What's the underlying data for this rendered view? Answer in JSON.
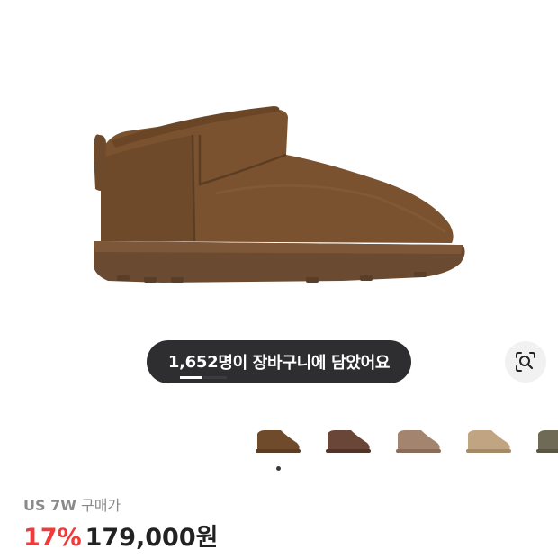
{
  "cart_notice": {
    "count": "1,652",
    "text": "명이 장바구니에 담았어요"
  },
  "icons": {
    "lens": "visual-search-icon"
  },
  "thumbnails": [
    {
      "label": "chestnut",
      "color": "#6f4a2b"
    },
    {
      "label": "burnt cedar",
      "color": "#6a4639"
    },
    {
      "label": "sand",
      "color": "#a3846f"
    },
    {
      "label": "mustard seed",
      "color": "#c1a582"
    },
    {
      "label": "burnt olive",
      "color": "#6f6a56"
    }
  ],
  "pagination": {
    "active_index": 0,
    "total": 1
  },
  "product": {
    "size": "US 7W",
    "price_type": "구매가",
    "discount": "17%",
    "price": "179,000원"
  },
  "colors": {
    "discount": "#ef3b3b",
    "pill_bg": "#2e2e31",
    "boot": "#7a5230"
  }
}
